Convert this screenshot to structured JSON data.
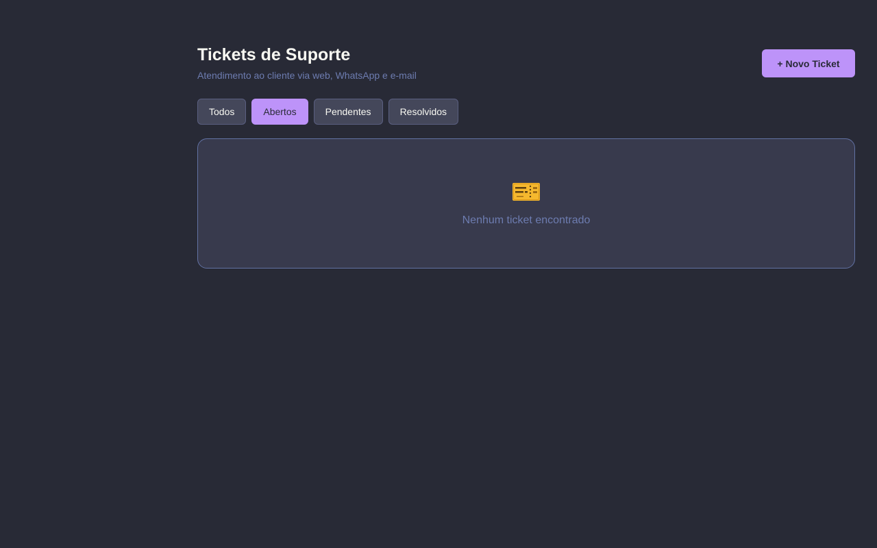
{
  "header": {
    "title": "Tickets de Suporte",
    "subtitle": "Atendimento ao cliente via web, WhatsApp e e-mail",
    "new_ticket_label": "+ Novo Ticket"
  },
  "tabs": [
    {
      "label": "Todos",
      "active": false
    },
    {
      "label": "Abertos",
      "active": true
    },
    {
      "label": "Pendentes",
      "active": false
    },
    {
      "label": "Resolvidos",
      "active": false
    }
  ],
  "empty_state": {
    "icon": "ticket-icon",
    "message": "Nenhum ticket encontrado"
  },
  "colors": {
    "background": "#282a36",
    "accent": "#bd93f9",
    "panel": "#383a4d",
    "muted_text": "#6d7cb0",
    "ticket_icon": "#f5b82e"
  }
}
